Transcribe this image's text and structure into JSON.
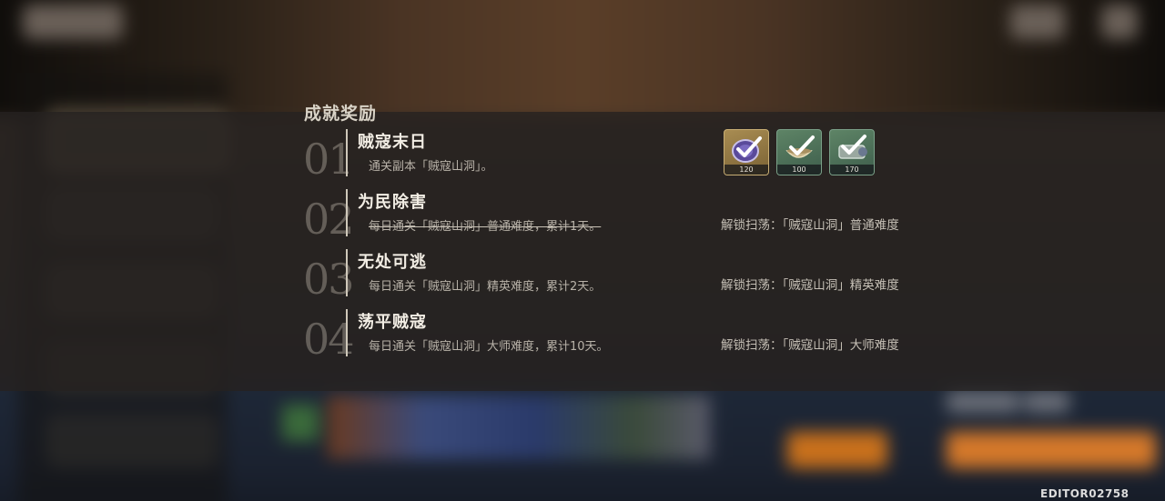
{
  "panel": {
    "title": "成就奖励"
  },
  "achievements": [
    {
      "number": "01",
      "name": "贼寇末日",
      "description": "通关副本「贼寇山洞」。",
      "reward": ""
    },
    {
      "number": "02",
      "name": "为民除害",
      "description": "每日通关「贼寇山洞」普通难度，累计1天。",
      "reward": "解锁扫荡：「贼寇山洞」普通难度"
    },
    {
      "number": "03",
      "name": "无处可逃",
      "description": "每日通关「贼寇山洞」精英难度，累计2天。",
      "reward": "解锁扫荡：「贼寇山洞」精英难度"
    },
    {
      "number": "04",
      "name": "荡平贼寇",
      "description": "每日通关「贼寇山洞」大师难度，累计10天。",
      "reward": "解锁扫荡：「贼寇山洞」大师难度"
    }
  ],
  "reward_items": [
    {
      "icon": "purple-orb-check-icon",
      "quantity": "120",
      "color": "#a88c52"
    },
    {
      "icon": "bowl-check-icon",
      "quantity": "100",
      "color": "#5e8466"
    },
    {
      "icon": "scroll-check-icon",
      "quantity": "170",
      "color": "#5e8466"
    }
  ],
  "footer": {
    "editor_id": "EDITOR02758"
  }
}
